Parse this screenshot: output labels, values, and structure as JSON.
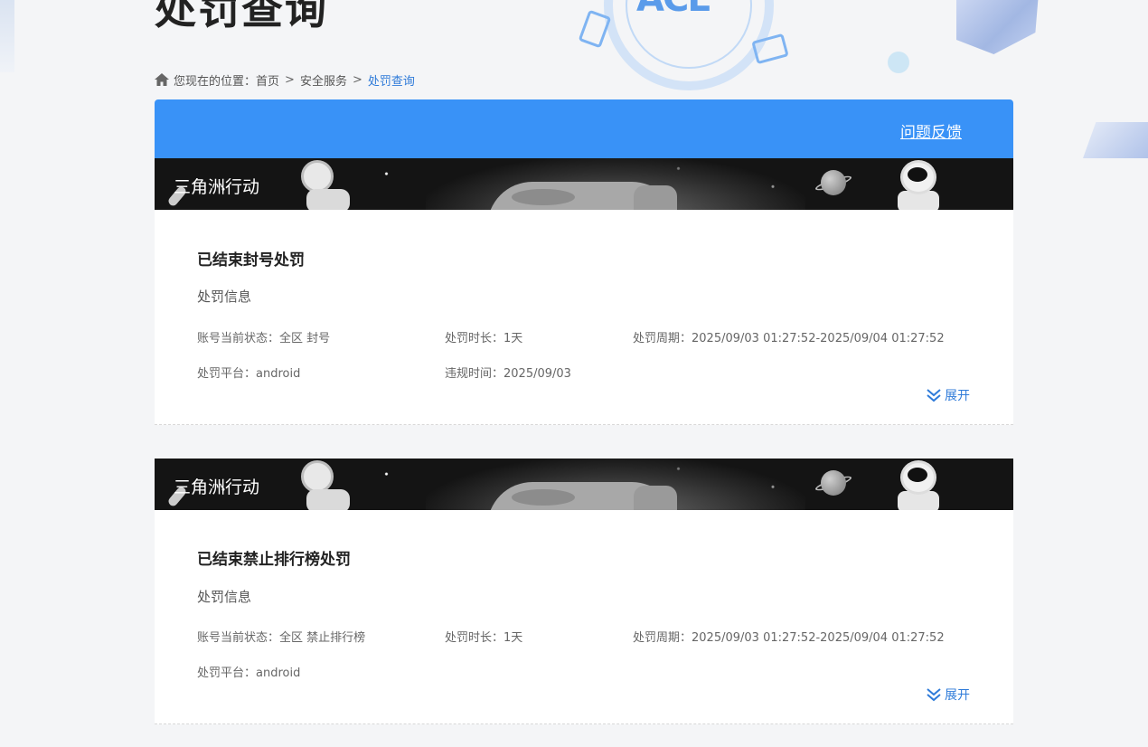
{
  "page": {
    "title": "处罚查询"
  },
  "breadcrumb": {
    "prefix": "您现在的位置：",
    "items": [
      "首页",
      "安全服务"
    ],
    "current": "处罚查询",
    "separator": ">"
  },
  "header": {
    "feedback_label": "问题反馈"
  },
  "penalties": [
    {
      "game": "三角洲行动",
      "title": "已结束封号处罚",
      "section_label": "处罚信息",
      "status_label": "账号当前状态：",
      "status_value": "全区 封号",
      "duration_label": "处罚时长：",
      "duration_value": "1天",
      "period_label": "处罚周期：",
      "period_value": "2025/09/03 01:27:52-2025/09/04 01:27:52",
      "platform_label": "处罚平台：",
      "platform_value": "android",
      "violation_label": "违规时间：",
      "violation_value": "2025/09/03",
      "expand_label": "展开"
    },
    {
      "game": "三角洲行动",
      "title": "已结束禁止排行榜处罚",
      "section_label": "处罚信息",
      "status_label": "账号当前状态：",
      "status_value": "全区 禁止排行榜",
      "duration_label": "处罚时长：",
      "duration_value": "1天",
      "period_label": "处罚周期：",
      "period_value": "2025/09/03 01:27:52-2025/09/04 01:27:52",
      "platform_label": "处罚平台：",
      "platform_value": "android",
      "expand_label": "展开"
    }
  ],
  "colors": {
    "accent": "#3992f7",
    "link": "#2f7bd9",
    "banner_bg": "#141414"
  },
  "decorations": {
    "background_logo_text": "ACE"
  }
}
